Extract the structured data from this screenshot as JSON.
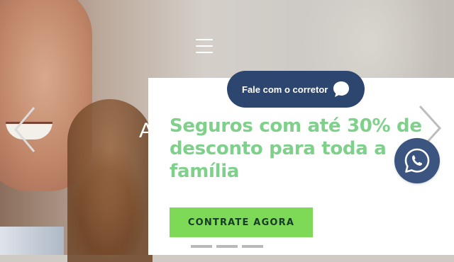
{
  "hero": {
    "partial_title_letter": "A"
  },
  "slide": {
    "headline": "Seguros com até 30% de desconto para toda a família",
    "cta_label": "CONTRATE AGORA",
    "pagination": {
      "count": 3
    }
  },
  "broker_button": {
    "label": "Fale com o corretor",
    "icon": "chat-bubble-icon"
  },
  "navigation": {
    "menu_icon": "hamburger-menu-icon",
    "prev_icon": "chevron-left-icon",
    "next_icon": "chevron-right-icon"
  },
  "whatsapp": {
    "icon": "whatsapp-icon"
  },
  "colors": {
    "headline": "#7ed08b",
    "cta_background": "#7ed957",
    "cta_text": "#163a2c",
    "broker_background": "#2d4670",
    "whatsapp_background": "#3b5580",
    "pagination": "#b9b9b9"
  }
}
